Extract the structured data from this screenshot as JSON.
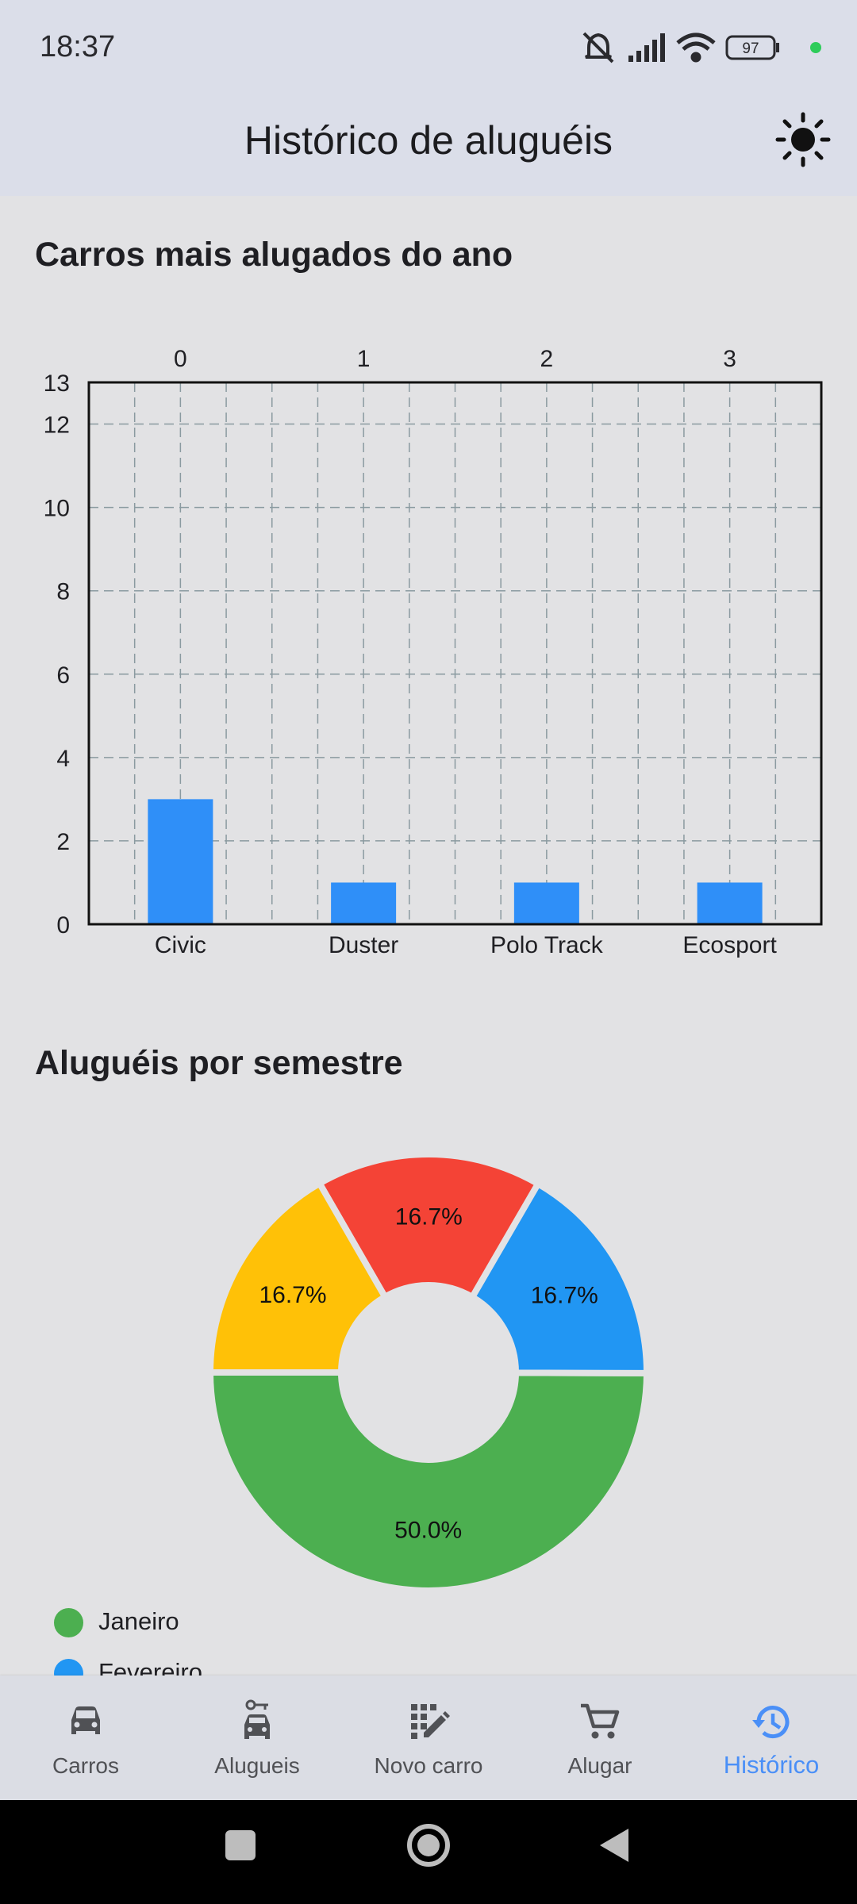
{
  "status_bar": {
    "time": "18:37",
    "battery": "97"
  },
  "app_bar": {
    "title": "Histórico de aluguéis",
    "theme_icon": "sun-icon"
  },
  "colors": {
    "bar": "#2f8ff8",
    "bar_top": "#3d86fb",
    "grid": "#8a9aa0",
    "green": "#4caf50",
    "blue": "#2196f3",
    "red": "#f44336",
    "yellow": "#ffc107",
    "active_nav": "#4a8ff7"
  },
  "sections": {
    "bar_chart_title": "Carros mais alugados do ano",
    "pie_chart_title": "Aluguéis por semestre"
  },
  "chart_data": [
    {
      "type": "bar",
      "categories": [
        "Civic",
        "Duster",
        "Polo Track",
        "Ecosport"
      ],
      "top_labels": [
        "0",
        "1",
        "2",
        "3"
      ],
      "values": [
        3,
        1,
        1,
        1
      ],
      "ylim": [
        0,
        13
      ],
      "yticks": [
        0,
        2,
        4,
        6,
        8,
        10,
        12,
        13
      ],
      "grid": true,
      "title": "",
      "xlabel": "",
      "ylabel": ""
    },
    {
      "type": "pie",
      "style": "donut",
      "labels": [
        "Janeiro",
        "Fevereiro",
        "",
        ""
      ],
      "values": [
        50.0,
        16.7,
        16.7,
        16.7
      ],
      "value_labels": [
        "50.0%",
        "16.7%",
        "16.7%",
        "16.7%"
      ],
      "colors": [
        "#4caf50",
        "#2196f3",
        "#f44336",
        "#ffc107"
      ],
      "legend_position": "bottom-left"
    }
  ],
  "legend": [
    {
      "label": "Janeiro",
      "color": "#4caf50"
    },
    {
      "label": "Fevereiro",
      "color": "#2196f3"
    }
  ],
  "nav": {
    "items": [
      {
        "label": "Carros",
        "icon": "car-icon"
      },
      {
        "label": "Alugueis",
        "icon": "car-key-icon"
      },
      {
        "label": "Novo carro",
        "icon": "edit-grid-icon"
      },
      {
        "label": "Alugar",
        "icon": "cart-icon"
      },
      {
        "label": "Histórico",
        "icon": "history-icon"
      }
    ],
    "active_index": 4
  },
  "system_nav": {
    "buttons": [
      "recents",
      "home",
      "back"
    ]
  }
}
